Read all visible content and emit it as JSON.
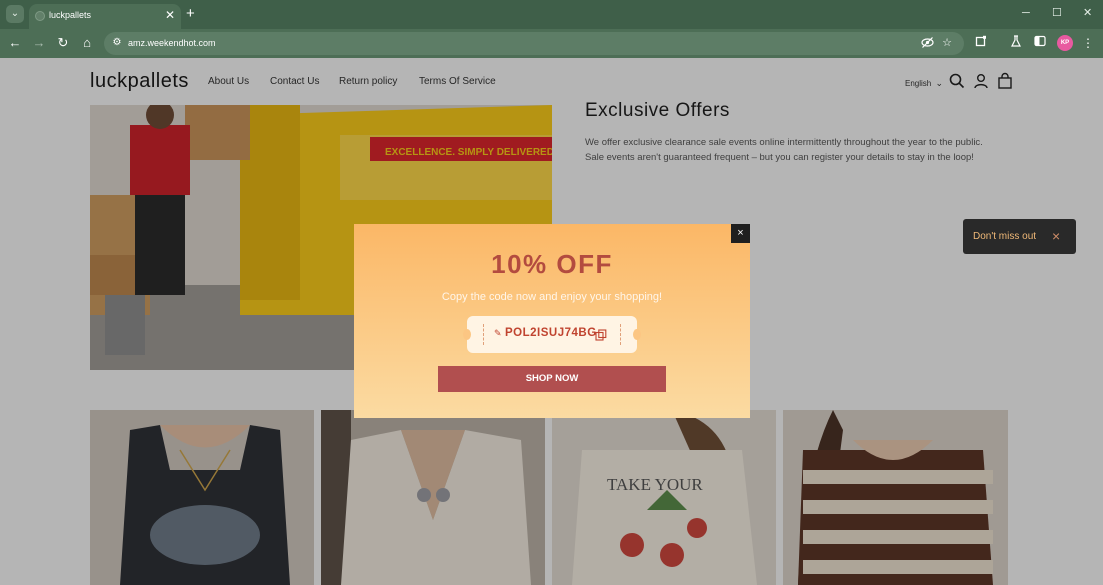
{
  "browser": {
    "tab_title": "luckpallets",
    "url": "amz.weekendhot.com",
    "profile_initials": "KP"
  },
  "header": {
    "logo": "luckpallets",
    "nav": [
      "About Us",
      "Contact Us",
      "Return policy",
      "Terms Of Service"
    ],
    "language": "English"
  },
  "hero": {
    "title": "Exclusive Offers",
    "text": "We offer exclusive clearance sale events online intermittently throughout the year to the public. Sale events aren't guaranteed frequent – but you can register your details to stay in the loop!",
    "van_text": "EXCELLENCE. SIMPLY DELIVERED."
  },
  "popup": {
    "title": "10% OFF",
    "subtitle": "Copy the code now and enjoy your shopping!",
    "code": "POL2ISUJ74BG",
    "button": "SHOP NOW",
    "close": "×"
  },
  "toast": {
    "text": "Don't miss out",
    "close": "×"
  },
  "products": {
    "count": 4,
    "tee_text": "TAKE YOUR"
  },
  "colors": {
    "brand_chrome": "#4d6e56",
    "popup_title": "#b34b3f",
    "shop_button": "#b14f4f",
    "toast_text": "#f0b978"
  }
}
